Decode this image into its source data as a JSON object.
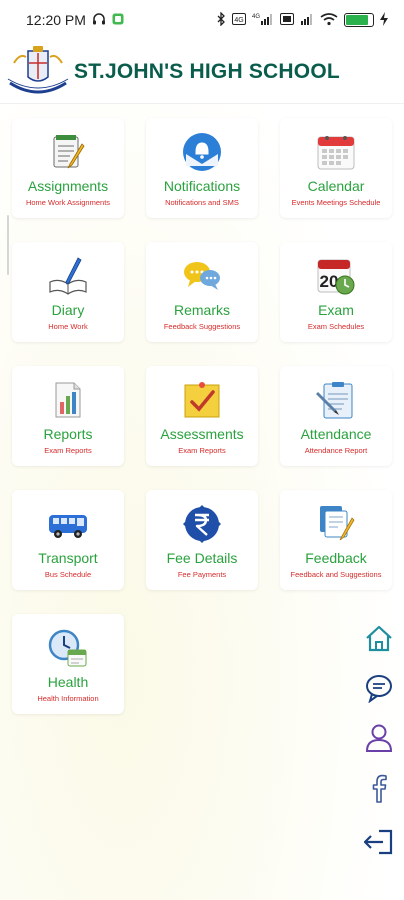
{
  "status": {
    "time": "12:20 PM",
    "network": "4G",
    "colors": {
      "battery": "#2bb24c"
    }
  },
  "header": {
    "school_name": "ST.JOHN'S HIGH SCHOOL",
    "logo_icon": "school-crest-icon"
  },
  "tiles": [
    {
      "title": "Assignments",
      "subtitle": "Home Work Assignments",
      "icon": "notepad-pencil-icon"
    },
    {
      "title": "Notifications",
      "subtitle": "Notifications and SMS",
      "icon": "bell-envelope-icon"
    },
    {
      "title": "Calendar",
      "subtitle": "Events Meetings Schedule",
      "icon": "calendar-icon"
    },
    {
      "title": "Diary",
      "subtitle": "Home Work",
      "icon": "open-book-pen-icon"
    },
    {
      "title": "Remarks",
      "subtitle": "Feedback Suggestions",
      "icon": "chat-bubbles-icon"
    },
    {
      "title": "Exam",
      "subtitle": "Exam Schedules",
      "icon": "calendar-clock-icon"
    },
    {
      "title": "Reports",
      "subtitle": "Exam Reports",
      "icon": "bar-chart-document-icon"
    },
    {
      "title": "Assessments",
      "subtitle": "Exam Reports",
      "icon": "checkmark-note-icon"
    },
    {
      "title": "Attendance",
      "subtitle": "Attendance Report",
      "icon": "clipboard-icon"
    },
    {
      "title": "Transport",
      "subtitle": "Bus Schedule",
      "icon": "bus-icon"
    },
    {
      "title": "Fee Details",
      "subtitle": "Fee Payments",
      "icon": "rupee-icon"
    },
    {
      "title": "Feedback",
      "subtitle": "Feedback and Suggestions",
      "icon": "documents-pencil-icon"
    },
    {
      "title": "Health",
      "subtitle": "Health Information",
      "icon": "clock-calendar-icon"
    }
  ],
  "side_nav": [
    {
      "icon": "home-icon"
    },
    {
      "icon": "chat-icon"
    },
    {
      "icon": "user-icon"
    },
    {
      "icon": "facebook-icon"
    },
    {
      "icon": "logout-icon"
    }
  ],
  "colors": {
    "title_green": "#2aa23e",
    "subtitle_red": "#d62b2b",
    "header_teal": "#0a5d4c",
    "nav_teal": "#1f8fa0",
    "nav_purple": "#6b3fa8"
  }
}
